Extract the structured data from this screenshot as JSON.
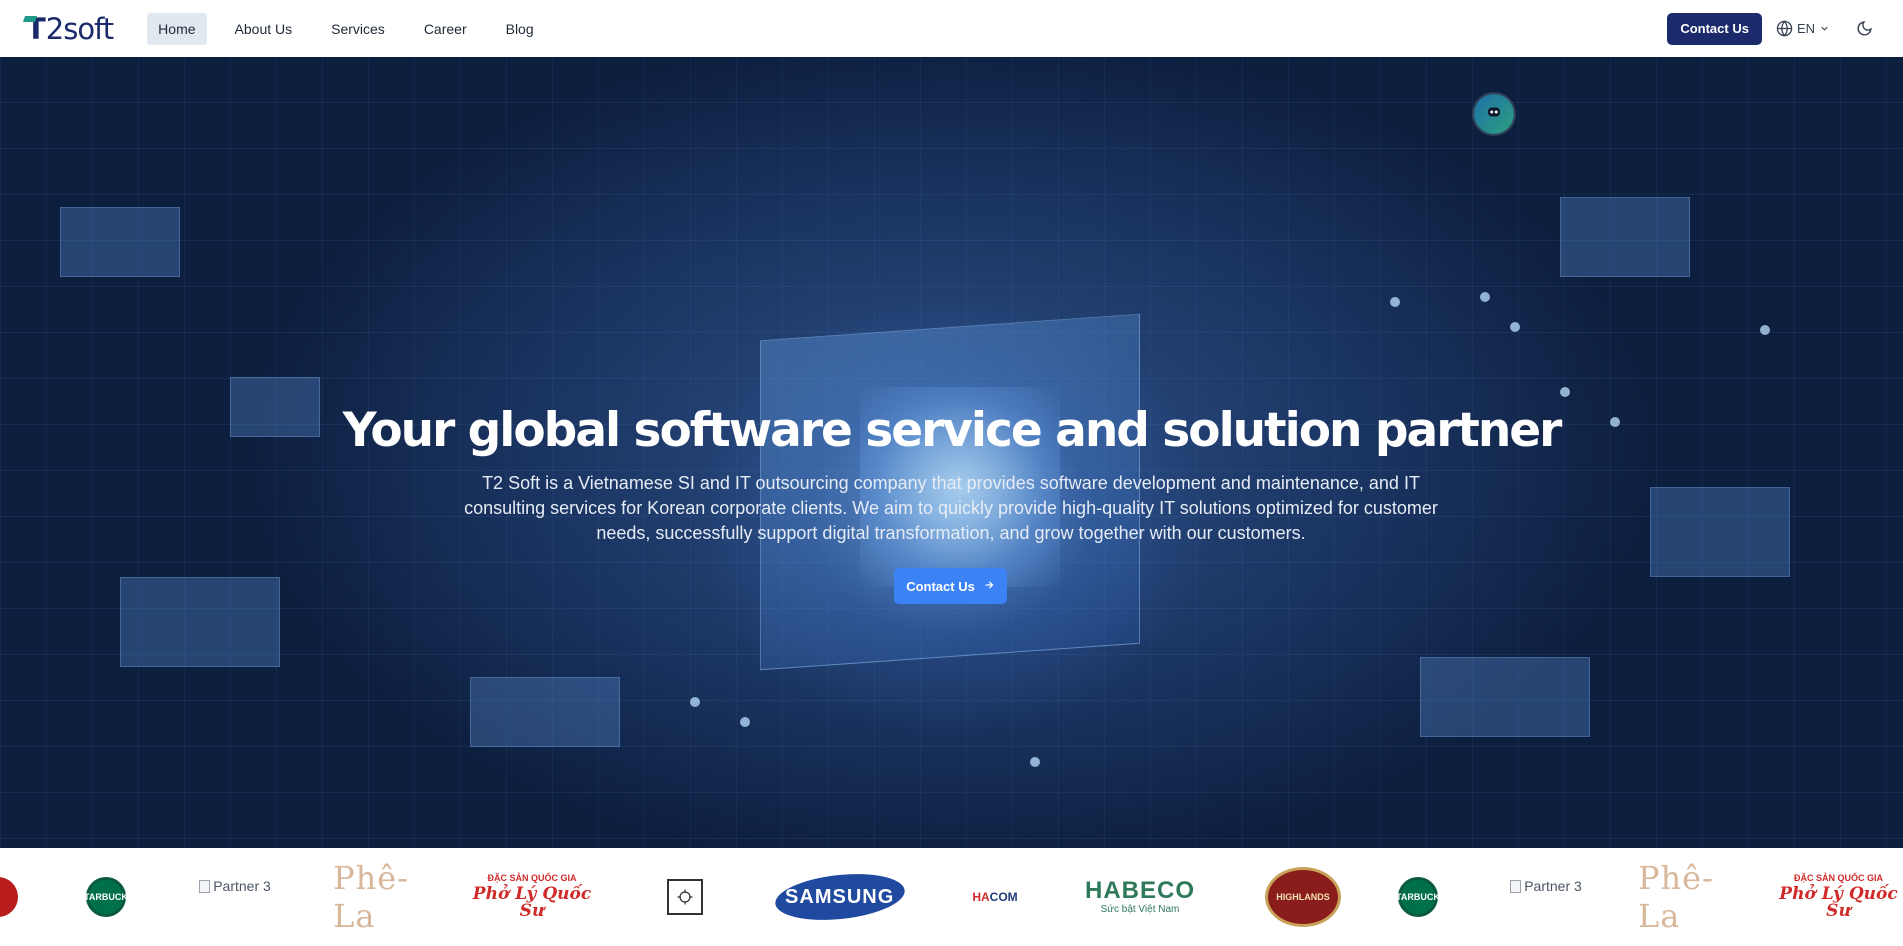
{
  "nav": {
    "logo_letter": "T",
    "logo_rest": "2soft",
    "links": [
      "Home",
      "About Us",
      "Services",
      "Career",
      "Blog"
    ],
    "active": "Home",
    "contact_label": "Contact Us",
    "language": "EN"
  },
  "hero": {
    "title": "Your global software service and solution partner",
    "description": "T2 Soft is a Vietnamese SI and IT outsourcing company that provides software development and maintenance, and IT consulting services for Korean corporate clients. We aim to quickly provide high-quality IT solutions optimized for customer needs, successfully support digital transformation, and grow together with our customers.",
    "cta_label": "Contact Us"
  },
  "partners": {
    "broken_alt": "Partner 3",
    "phela": "Phê-La",
    "pholy_small": "ĐẶC SẢN QUỐC GIA",
    "pholy_big": "Phở Lý Quốc Sư",
    "samsung": "SAMSUNG",
    "hacom_a": "HA",
    "hacom_b": "COM",
    "habeco_name": "HABECO",
    "habeco_sub": "Sức bật Việt Nam",
    "starbucks": "STARBUCKS",
    "highlands": "HIGHLANDS"
  },
  "colors": {
    "brand_navy": "#1b2a6b",
    "accent_blue": "#3b82f6",
    "teal": "#1f9a8a"
  },
  "icons": [
    "globe-icon",
    "chevron-down-icon",
    "moon-icon",
    "arrow-right-icon",
    "assistant-bot-icon"
  ]
}
